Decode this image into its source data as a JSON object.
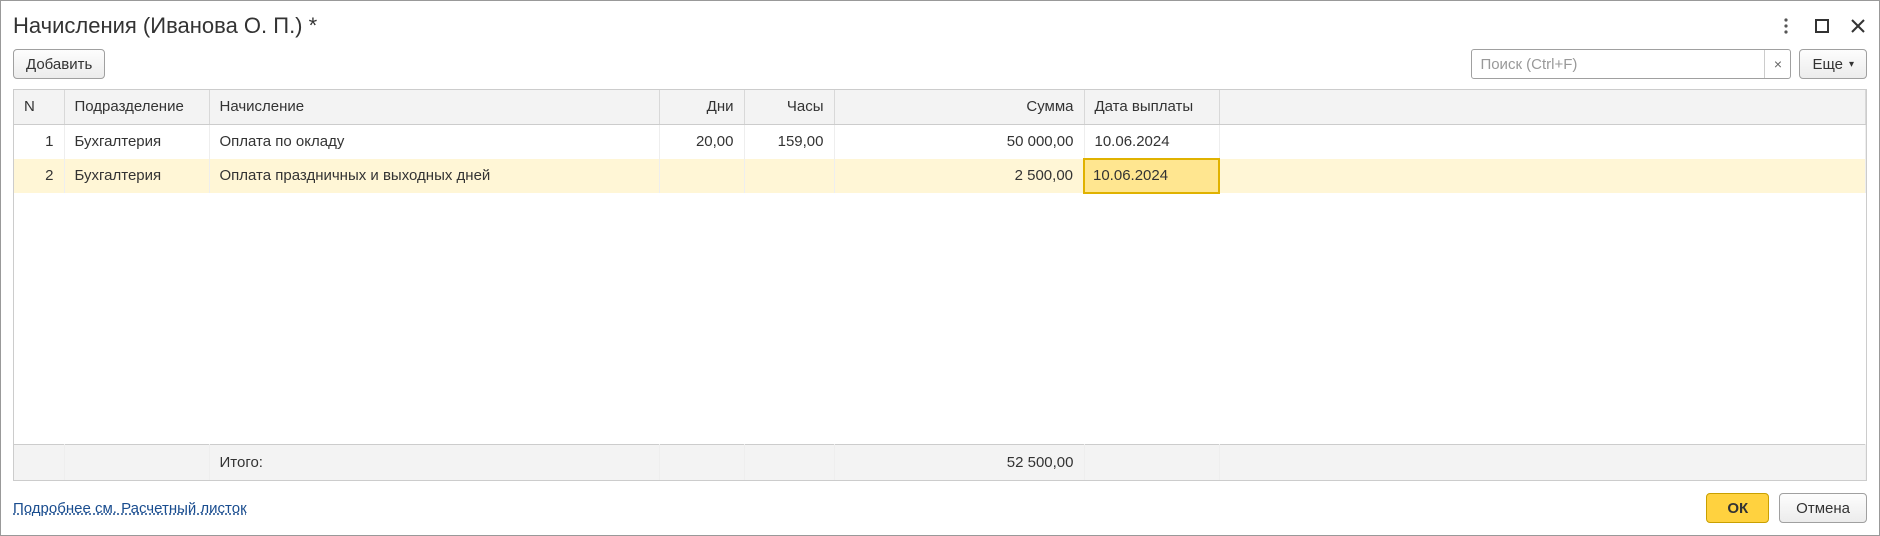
{
  "title": "Начисления (Иванова О. П.) *",
  "toolbar": {
    "add_label": "Добавить",
    "search_placeholder": "Поиск (Ctrl+F)",
    "more_label": "Еще"
  },
  "columns": {
    "n": "N",
    "department": "Подразделение",
    "accrual": "Начисление",
    "days": "Дни",
    "hours": "Часы",
    "sum": "Сумма",
    "pay_date": "Дата выплаты"
  },
  "rows": [
    {
      "n": "1",
      "department": "Бухгалтерия",
      "accrual": "Оплата по окладу",
      "days": "20,00",
      "hours": "159,00",
      "sum": "50 000,00",
      "pay_date": "10.06.2024",
      "selected": false
    },
    {
      "n": "2",
      "department": "Бухгалтерия",
      "accrual": "Оплата праздничных и выходных дней",
      "days": "",
      "hours": "",
      "sum": "2 500,00",
      "pay_date": "10.06.2024",
      "selected": true,
      "active_cell": "pay_date"
    }
  ],
  "totals": {
    "label": "Итого:",
    "sum": "52 500,00"
  },
  "footer": {
    "link": "Подробнее см. Расчетный листок",
    "ok": "ОК",
    "cancel": "Отмена"
  }
}
